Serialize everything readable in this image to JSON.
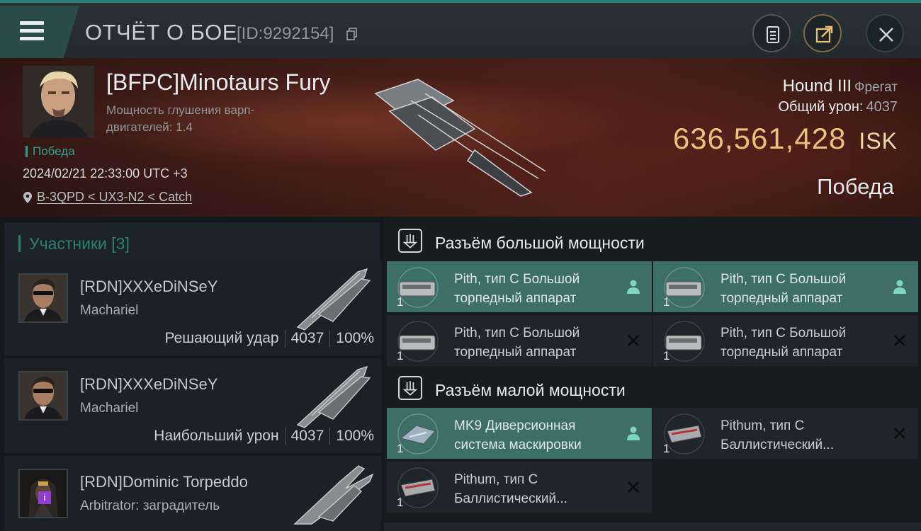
{
  "header": {
    "title": "ОТЧЁТ О БОЕ",
    "report_id": "[ID:9292154]",
    "icons": {
      "menu": "menu-icon",
      "copy": "copy-icon",
      "clipboard": "clipboard-icon",
      "export": "export-icon",
      "close": "close-icon"
    }
  },
  "victim": {
    "pilot_name": "[BFPC]Minotaurs Fury",
    "attribute": "Мощность глушения варп-двигателей: 1.4",
    "result_tag": "Победа",
    "datetime": "2024/02/21 22:33:00 UTC +3",
    "location": "B-3QPD < UX3-N2 < Catch",
    "ship_name": "Hound III",
    "ship_class": "Фрегат",
    "total_damage_label": "Общий урон:",
    "total_damage_value": "4037",
    "isk_value": "636,561,428",
    "isk_unit": "ISK",
    "outcome": "Победа"
  },
  "participants": {
    "header": "Участники [3]",
    "rows": [
      {
        "name": "[RDN]XXXeDiNSeY",
        "ship": "Machariel",
        "role": "Решающий удар",
        "damage": "4037",
        "percent": "100%"
      },
      {
        "name": "[RDN]XXXeDiNSeY",
        "ship": "Machariel",
        "role": "Наибольший урон",
        "damage": "4037",
        "percent": "100%"
      },
      {
        "name": "[RDN]Dominic Torpeddo",
        "ship": "Arbitrator: заградитель",
        "role": "",
        "damage": "",
        "percent": "",
        "badge": "i"
      }
    ]
  },
  "slots": {
    "high_power": {
      "title": "Разъём большой мощности",
      "modules": [
        {
          "name": "Pith, тип C Большой торпедный аппарат",
          "qty": "1",
          "status": "dropped",
          "active": true
        },
        {
          "name": "Pith, тип C Большой торпедный аппарат",
          "qty": "1",
          "status": "dropped",
          "active": true
        },
        {
          "name": "Pith, тип C Большой торпедный аппарат",
          "qty": "1",
          "status": "destroyed",
          "active": false
        },
        {
          "name": "Pith, тип C Большой торпедный аппарат",
          "qty": "1",
          "status": "destroyed",
          "active": false
        }
      ]
    },
    "low_power": {
      "title": "Разъём малой мощности",
      "modules": [
        {
          "name": "MK9 Диверсионная система маскировки",
          "qty": "1",
          "status": "dropped",
          "active": true
        },
        {
          "name": "Pithum, тип C Баллистический...",
          "qty": "1",
          "status": "destroyed",
          "active": false
        },
        {
          "name": "Pithum, тип C Баллистический...",
          "qty": "1",
          "status": "destroyed",
          "active": false
        }
      ]
    }
  },
  "colors": {
    "accent_teal": "#2e7d73",
    "isk_gold": "#e9c17b",
    "active_module": "#3d6f67",
    "victory_green": "#2fa18f"
  }
}
